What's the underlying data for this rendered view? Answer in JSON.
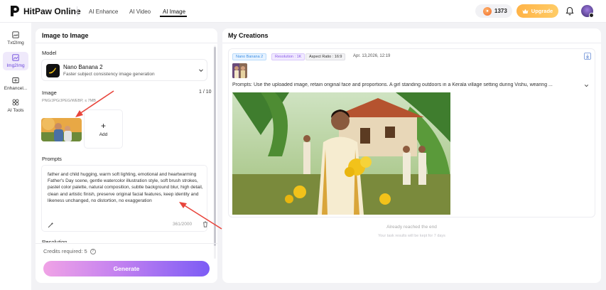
{
  "app": {
    "brand": "HitPaw Online"
  },
  "nav": {
    "items": [
      "AI Enhance",
      "AI Video",
      "AI Image"
    ],
    "active": "AI Image"
  },
  "header": {
    "credits": "1373",
    "upgrade_label": "Upgrade"
  },
  "sidebar": {
    "items": [
      {
        "label": "Txt2Img",
        "icon": "text-image-icon"
      },
      {
        "label": "Img2Img",
        "icon": "image-image-icon",
        "active": true
      },
      {
        "label": "Enhancel...",
        "icon": "enhance-icon"
      },
      {
        "label": "AI Tools",
        "icon": "tools-icon"
      }
    ]
  },
  "left_panel": {
    "title": "Image to Image",
    "model_label": "Model",
    "model": {
      "name": "Nano Banana 2",
      "description": "Faster subject consistency image generation"
    },
    "image_label": "Image",
    "image_count": "1 / 10",
    "formats": "PNG/JPG/JPEG/WEBP, ≤ 7MB",
    "add_label": "Add",
    "prompts_label": "Prompts",
    "prompt_text": "father and child hugging, warm soft lighting, emotional and heartwarming Father's Day scene, gentle watercolor illustration style, soft brush strokes, pastel color palette, natural composition, subtle background blur, high detail, clean and artistic finish, preserve original facial features, keep identity and likeness unchanged, no distortion, no exaggeration",
    "char_count": "361/2000",
    "resolution_label": "Resolution",
    "credits_required": "Credits required: 5",
    "generate_label": "Generate"
  },
  "right_panel": {
    "title": "My Creations",
    "tags": {
      "model": "Nano Banana 2",
      "resolution": "Resolution : 1K",
      "aspect": "Aspect Ratio : 16:9"
    },
    "date": "Apr. 13,2026, 12:19",
    "prompt_line": "Prompts: Use the uploaded image, retain original face and proportions. A girl standing outdoors in a Kerala village setting during Vishu, wearing ...",
    "end_text": "Already reached the end",
    "keep_text": "Your task results will be kept for 7 days"
  },
  "colors": {
    "accent": "#6b47dc",
    "upgrade": "#ffb347",
    "arrow": "#e8453c"
  }
}
